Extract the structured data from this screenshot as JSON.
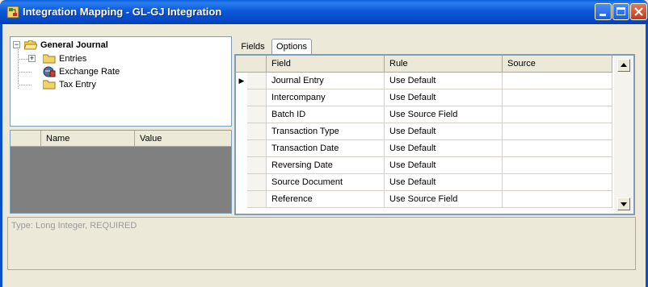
{
  "window": {
    "title": "Integration Mapping - GL-GJ Integration",
    "icon": "mapping-app-icon"
  },
  "tree": {
    "root": {
      "label": "General Journal",
      "expander": "−"
    },
    "children": [
      {
        "label": "Entries",
        "icon": "folder-icon",
        "expander": "+"
      },
      {
        "label": "Exchange Rate",
        "icon": "exchange-rate-icon"
      },
      {
        "label": "Tax Entry",
        "icon": "folder-icon"
      }
    ]
  },
  "properties": {
    "headers": {
      "name": "Name",
      "value": "Value"
    }
  },
  "tabs": [
    {
      "label": "Fields",
      "active": false
    },
    {
      "label": "Options",
      "active": true
    }
  ],
  "grid": {
    "headers": {
      "field": "Field",
      "rule": "Rule",
      "source": "Source"
    },
    "rows": [
      {
        "field": "Journal Entry",
        "rule": "Use Default",
        "source": "",
        "current": true
      },
      {
        "field": "Intercompany",
        "rule": "Use Default",
        "source": ""
      },
      {
        "field": "Batch ID",
        "rule": "Use Source Field",
        "source": ""
      },
      {
        "field": "Transaction Type",
        "rule": "Use Default",
        "source": ""
      },
      {
        "field": "Transaction Date",
        "rule": "Use Default",
        "source": ""
      },
      {
        "field": "Reversing Date",
        "rule": "Use Default",
        "source": ""
      },
      {
        "field": "Source Document",
        "rule": "Use Default",
        "source": ""
      },
      {
        "field": "Reference",
        "rule": "Use Source Field",
        "source": ""
      }
    ],
    "row_indicator": "▶"
  },
  "status": {
    "text": "Type: Long Integer, REQUIRED"
  },
  "colors": {
    "titlebar": "#0448c8",
    "grey_panel": "#808080",
    "window_bg": "#ece9d8"
  }
}
